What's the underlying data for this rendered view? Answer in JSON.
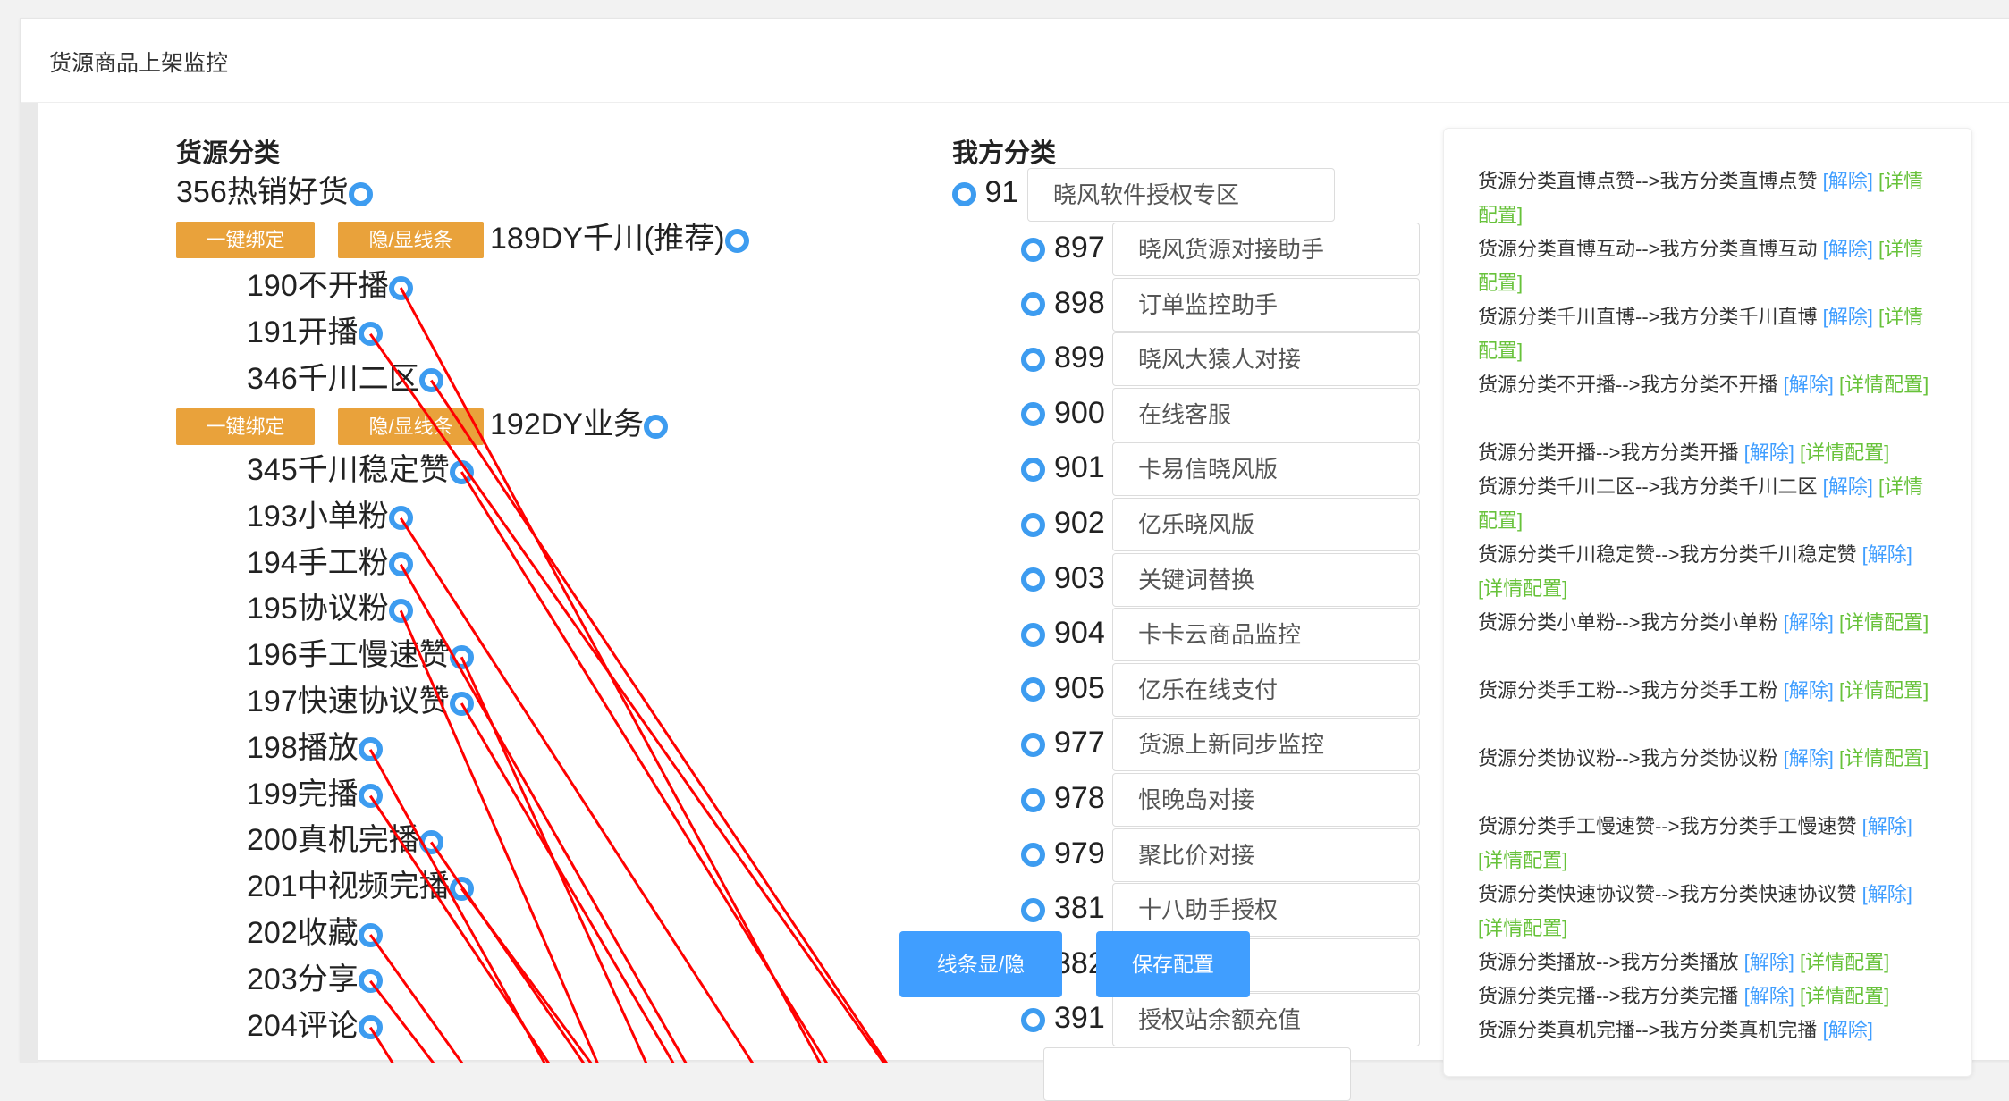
{
  "panel": {
    "title": "货源商品上架监控"
  },
  "left": {
    "heading": "货源分类",
    "bind_label": "一键绑定",
    "toggle_label": "隐/显线条",
    "root": "356热销好货",
    "groups": [
      {
        "name": "189DY千川(推荐)",
        "children": [
          "190不开播",
          "191开播",
          "346千川二区"
        ]
      },
      {
        "name": "192DY业务",
        "children": [
          "345千川稳定赞",
          "193小单粉",
          "194手工粉",
          "195协议粉",
          "196手工慢速赞",
          "197快速协议赞",
          "198播放",
          "199完播",
          "200真机完播",
          "201中视频完播",
          "202收藏",
          "203分享",
          "204评论"
        ]
      }
    ]
  },
  "right": {
    "heading": "我方分类",
    "root": {
      "id": "91",
      "name": "晓风软件授权专区"
    },
    "items": [
      {
        "id": "897",
        "name": "晓风货源对接助手"
      },
      {
        "id": "898",
        "name": "订单监控助手"
      },
      {
        "id": "899",
        "name": "晓风大猿人对接"
      },
      {
        "id": "900",
        "name": "在线客服"
      },
      {
        "id": "901",
        "name": "卡易信晓风版"
      },
      {
        "id": "902",
        "name": "亿乐晓风版"
      },
      {
        "id": "903",
        "name": "关键词替换"
      },
      {
        "id": "904",
        "name": "卡卡云商品监控"
      },
      {
        "id": "905",
        "name": "亿乐在线支付"
      },
      {
        "id": "977",
        "name": "货源上新同步监控"
      },
      {
        "id": "978",
        "name": "恨晚岛对接"
      },
      {
        "id": "979",
        "name": "聚比价对接"
      },
      {
        "id": "381",
        "name": "十八助手授权"
      },
      {
        "id": "382",
        "name": ""
      },
      {
        "id": "391",
        "name": "授权站余额充值"
      }
    ]
  },
  "actions": {
    "toggle_lines": "线条显/隐",
    "save": "保存配置"
  },
  "mappings": {
    "unbind_label": "[解除]",
    "config_label": "[详情配置]",
    "lines": [
      {
        "text": "货源分类直博点赞-->我方分类直博点赞",
        "unbind": "[解除]",
        "config": "[详情配置]"
      },
      {
        "text": "货源分类直博互动-->我方分类直博互动",
        "unbind": "[解除]",
        "config": "[详情配置]"
      },
      {
        "text": "货源分类千川直博-->我方分类千川直博",
        "unbind": "[解除]",
        "config": "[详情配置]"
      },
      {
        "text": "货源分类不开播-->我方分类不开播",
        "unbind": "[解除]",
        "config": "[详情配置]"
      },
      {
        "text": "货源分类开播-->我方分类开播",
        "unbind": "[解除]",
        "config": "[详情配置]"
      },
      {
        "text": "货源分类千川二区-->我方分类千川二区",
        "unbind": "[解除]",
        "config": "[详情配置]"
      },
      {
        "text": "货源分类千川稳定赞-->我方分类千川稳定赞",
        "unbind": "[解除]",
        "config": "[详情配置]"
      },
      {
        "text": "货源分类小单粉-->我方分类小单粉",
        "unbind": "[解除]",
        "config": "[详情配置]"
      },
      {
        "text": "货源分类手工粉-->我方分类手工粉",
        "unbind": "[解除]",
        "config": "[详情配置]"
      },
      {
        "text": "货源分类协议粉-->我方分类协议粉",
        "unbind": "[解除]",
        "config": "[详情配置]"
      },
      {
        "text": "货源分类手工慢速赞-->我方分类手工慢速赞",
        "unbind": "[解除]",
        "config": "[详情配置]"
      },
      {
        "text": "货源分类快速协议赞-->我方分类快速协议赞",
        "unbind": "[解除]",
        "config": "[详情配置]"
      },
      {
        "text": "货源分类播放-->我方分类播放",
        "unbind": "[解除]",
        "config": "[详情配置]"
      },
      {
        "text": "货源分类完播-->我方分类完播",
        "unbind": "[解除]",
        "config": "[详情配置]"
      },
      {
        "text": "货源分类真机完播-->我方分类真机完播",
        "unbind": "[解除]",
        "config": ""
      }
    ]
  },
  "colors": {
    "accent": "#409eff",
    "orange": "#e9a23b",
    "green": "#67c23a",
    "line": "#ff0000"
  }
}
